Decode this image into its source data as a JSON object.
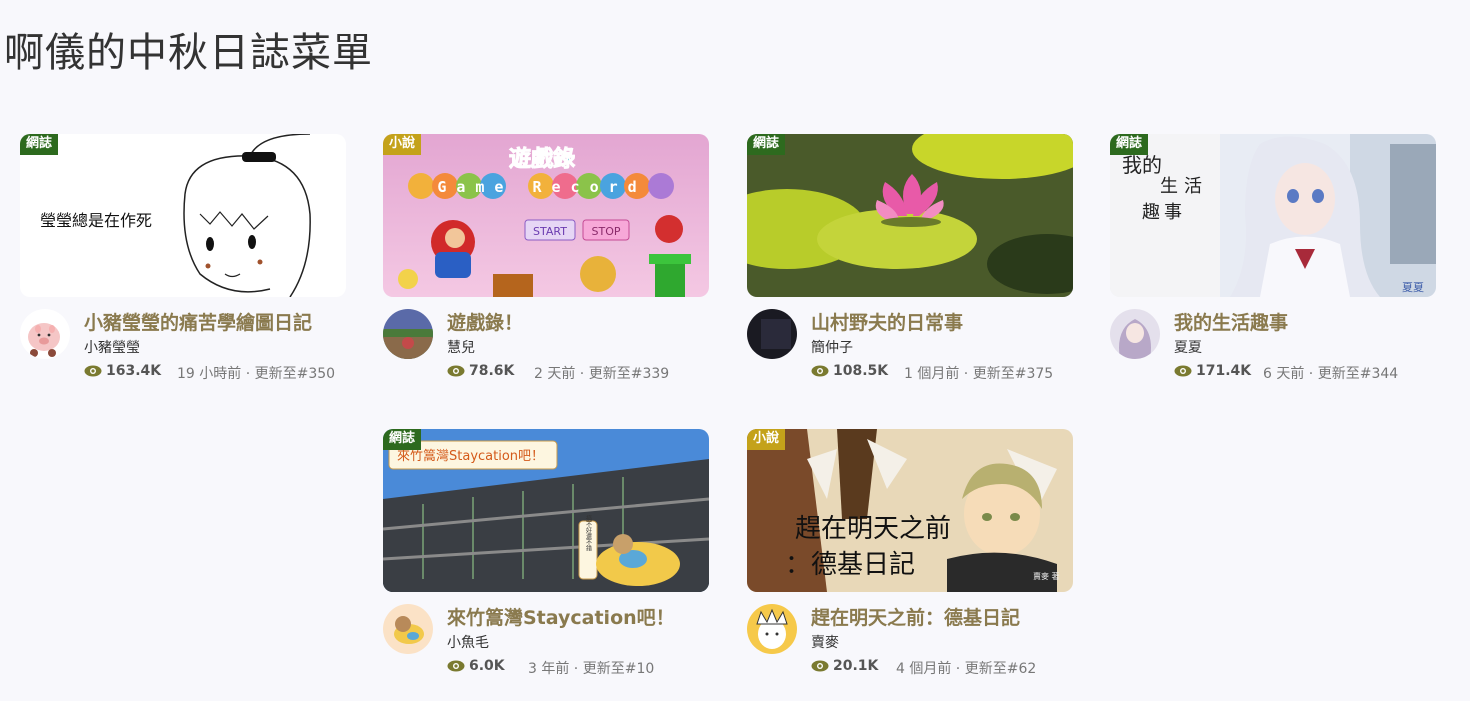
{
  "page": {
    "title": "啊儀的中秋日誌菜單"
  },
  "cards": [
    {
      "badge": "網誌",
      "thumb_text": "瑩瑩總是在作死",
      "title": "小豬瑩瑩的痛苦學繪圖日記",
      "author": "小豬瑩瑩",
      "views": "163.4K",
      "meta": "19 小時前 · 更新至#350"
    },
    {
      "badge": "小說",
      "thumb_title": "遊戲錄",
      "thumb_sub": "Game Record",
      "thumb_start": "START",
      "thumb_stop": "STOP",
      "title": "遊戲錄！",
      "author": "慧兒",
      "views": "78.6K",
      "meta": "2 天前 · 更新至#339"
    },
    {
      "badge": "網誌",
      "title": "山村野夫的日常事",
      "author": "簡仲子",
      "views": "108.5K",
      "meta": "1 個月前 · 更新至#375"
    },
    {
      "badge": "網誌",
      "thumb_text1": "我的",
      "thumb_text2": "生活",
      "thumb_text3": "趣事",
      "thumb_sign": "夏夏",
      "title": "我的生活趣事",
      "author": "夏夏",
      "views": "171.4K",
      "meta": "6 天前 · 更新至#344"
    },
    {
      "badge": "網誌",
      "thumb_text": "來竹篙灣Staycation吧！",
      "thumb_side": "搞不好還不錯",
      "title": "來竹篙灣Staycation吧！",
      "author": "小魚毛",
      "views": "6.0K",
      "meta": "3 年前 · 更新至#10"
    },
    {
      "badge": "小說",
      "thumb_text1": "趕在明天之前",
      "thumb_text2": "：德基日記",
      "thumb_sign": "賣麥 著",
      "title": "趕在明天之前：德基日記",
      "author": "賣麥",
      "views": "20.1K",
      "meta": "4 個月前 · 更新至#62"
    }
  ],
  "colors": {
    "title": "#8a7a4e",
    "badge_web": "#2d6a1e",
    "badge_novel": "#c4a21a",
    "eye": "#7a7a30"
  }
}
